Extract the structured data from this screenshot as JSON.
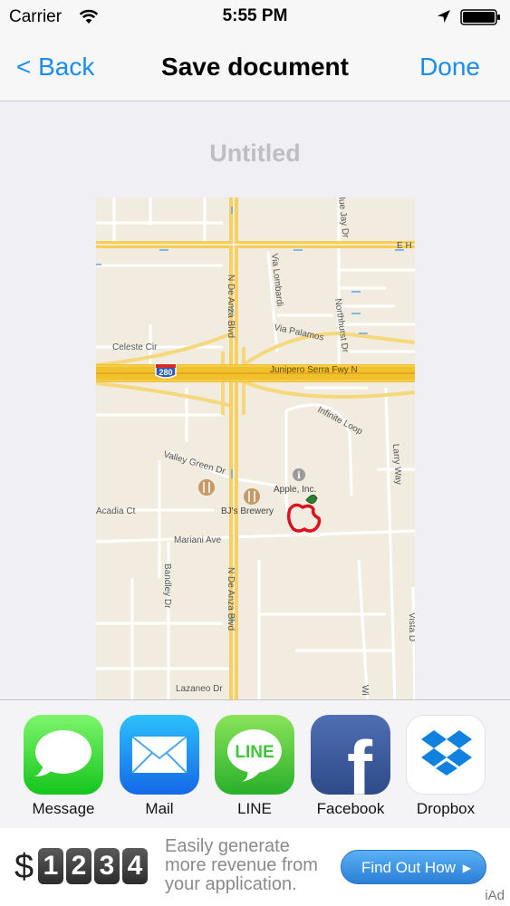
{
  "status_bar": {
    "carrier": "Carrier",
    "time": "5:55 PM"
  },
  "nav": {
    "back": "< Back",
    "title": "Save document",
    "done": "Done"
  },
  "document": {
    "title": "Untitled"
  },
  "map": {
    "labels": {
      "n_de_anza_blvd_top": "N De Anza Blvd",
      "n_de_anza_blvd_bottom": "N De Anza Blvd",
      "e_h": "E H",
      "via_lombardi": "Via Lombardi",
      "blue_jay_dr": "lue Jay Dr",
      "northhurst_dr": "Northhurst Dr",
      "via_palamos": "Via Palamos",
      "celeste_cir": "Celeste Cir",
      "highway_shield": "280",
      "junipero_serra": "Junipero Serra Fwy N",
      "infinite_loop": "Infinite Loop",
      "larry_way": "Larry Way",
      "valley_green_dr": "Valley Green Dr",
      "apple_inc": "Apple, Inc.",
      "bjs_brewery": "BJ's Brewery",
      "acadia_ct": "Acadia Ct",
      "mariani_ave": "Mariani Ave",
      "bandley_dr": "Bandley Dr",
      "vista_dr": "Vista D",
      "lazaneo_dr": "Lazaneo Dr",
      "wi": "Wi"
    }
  },
  "share": {
    "items": [
      {
        "label": "Message",
        "icon": "message-icon"
      },
      {
        "label": "Mail",
        "icon": "mail-icon"
      },
      {
        "label": "LINE",
        "icon": "line-icon"
      },
      {
        "label": "Facebook",
        "icon": "facebook-icon"
      },
      {
        "label": "Dropbox",
        "icon": "dropbox-icon"
      }
    ],
    "line_logo_text": "LINE",
    "facebook_logo_text": "f"
  },
  "ad": {
    "dollar": "$",
    "digits": [
      "1",
      "2",
      "3",
      "4"
    ],
    "line1": "Easily generate",
    "line2": "more revenue from",
    "line3": "your application.",
    "cta": "Find Out How",
    "cta_arrow": "▶",
    "brand": "iAd"
  },
  "colors": {
    "accent": "#1a8cf0",
    "map_background": "#f1ecdf",
    "highway": "#f0c12c",
    "major_road": "#f6d87c",
    "messages_green": "#4cd964",
    "mail_blue": "#1d9bf0",
    "line_green": "#3ec63a",
    "facebook_blue": "#3b5998",
    "dropbox_blue": "#1081de"
  }
}
